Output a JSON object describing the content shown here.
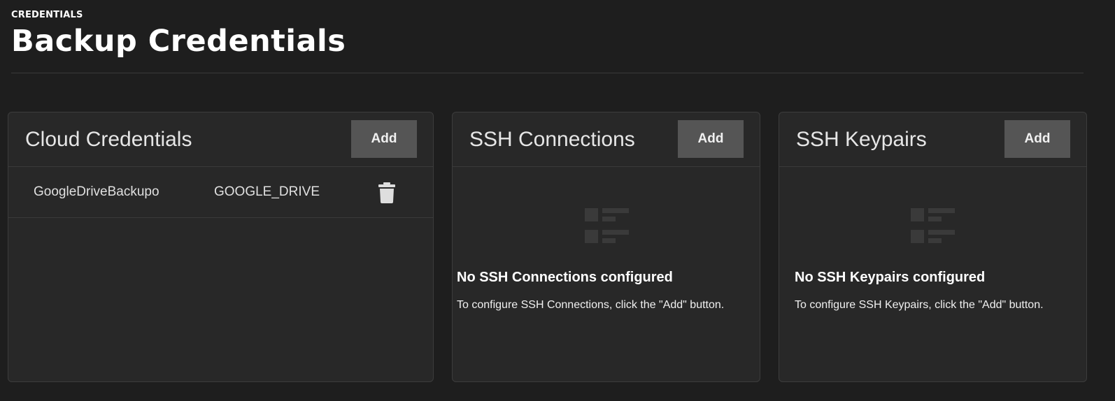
{
  "header": {
    "breadcrumb": "CREDENTIALS",
    "title": "Backup Credentials"
  },
  "cloud_credentials": {
    "title": "Cloud Credentials",
    "add_label": "Add",
    "items": [
      {
        "name": "GoogleDriveBackupo",
        "provider": "GOOGLE_DRIVE"
      }
    ]
  },
  "ssh_connections": {
    "title": "SSH Connections",
    "add_label": "Add",
    "empty_title": "No SSH Connections configured",
    "empty_text": "To configure SSH Connections, click the \"Add\" button."
  },
  "ssh_keypairs": {
    "title": "SSH Keypairs",
    "add_label": "Add",
    "empty_title": "No SSH Keypairs configured",
    "empty_text": "To configure SSH Keypairs, click the \"Add\" button."
  },
  "colors": {
    "background": "#1e1e1e",
    "card": "#282828",
    "button": "#555555",
    "empty_icon": "#3a3a3a"
  },
  "icons": {
    "delete": "trash-icon",
    "empty": "list-icon"
  }
}
